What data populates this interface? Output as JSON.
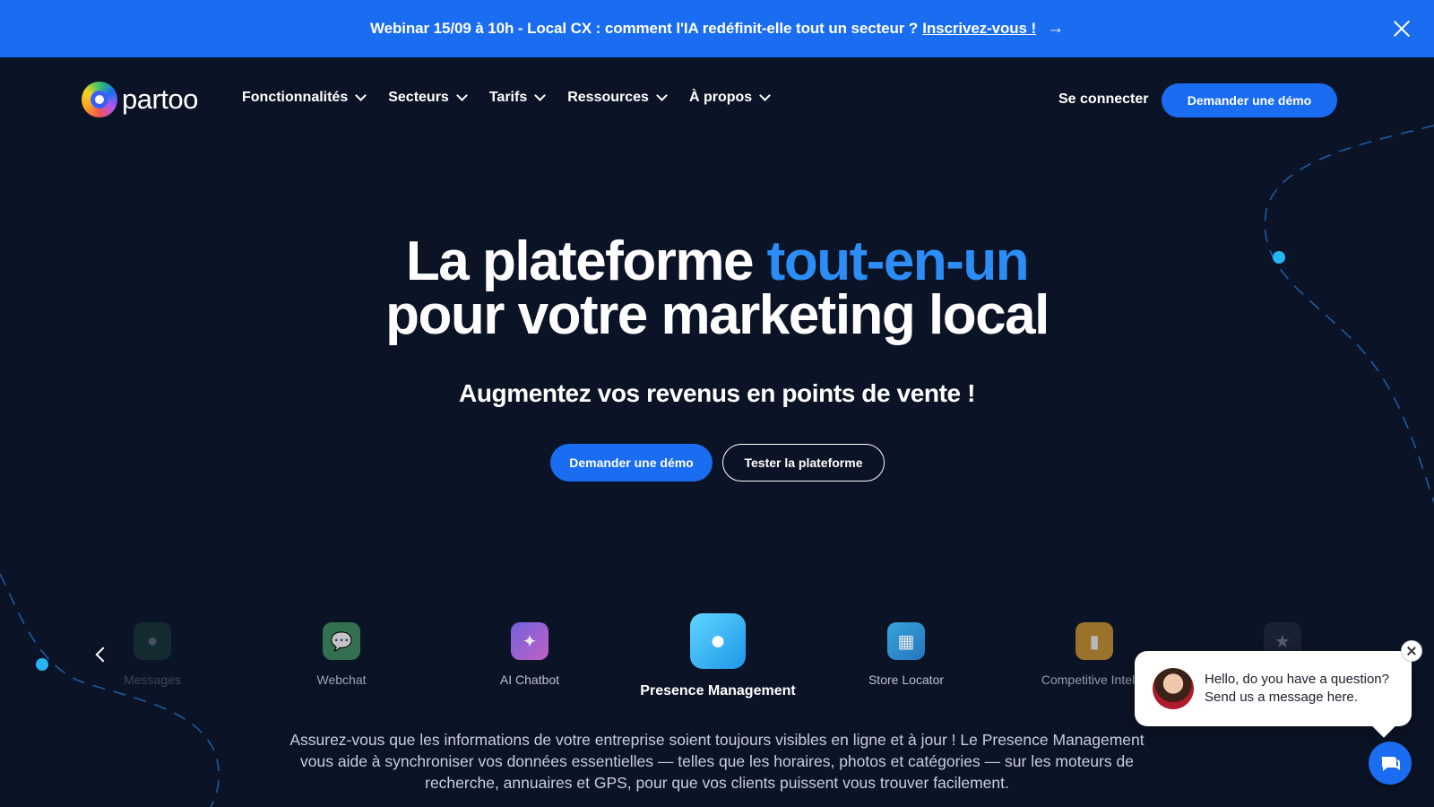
{
  "banner": {
    "text": "Webinar 15/09 à 10h - Local CX : comment l'IA redéfinit-elle tout un secteur ?",
    "link": "Inscrivez-vous !",
    "arrow_icon": "arrow-right-icon",
    "close_icon": "close-icon",
    "background": "#1a6cf0"
  },
  "nav": {
    "logo_text": "partoo",
    "items": [
      {
        "label": "Fonctionnalités"
      },
      {
        "label": "Secteurs"
      },
      {
        "label": "Tarifs"
      },
      {
        "label": "Ressources"
      },
      {
        "label": "À propos"
      }
    ],
    "login": "Se connecter",
    "demo": "Demander une démo"
  },
  "hero": {
    "title_part1": "La plateforme",
    "title_accent": "tout-en-un",
    "title_line2": "pour votre marketing local",
    "subtitle": "Augmentez vos revenus en points de vente !",
    "cta_primary": "Demander une démo",
    "cta_secondary": "Tester la plateforme",
    "accent_color": "#2b8df5"
  },
  "features": {
    "items": [
      {
        "label": "Messages",
        "icon": "messages-icon",
        "color": "#2f6b4f"
      },
      {
        "label": "Webchat",
        "icon": "webchat-icon",
        "color": "#3f8f5f"
      },
      {
        "label": "AI Chatbot",
        "icon": "sparkle-icon",
        "color": "#a45ad6"
      },
      {
        "label": "Presence Management",
        "icon": "presence-icon",
        "color": "#27b4f2"
      },
      {
        "label": "Store Locator",
        "icon": "store-icon",
        "color": "#2a9fd8"
      },
      {
        "label": "Competitive Intellig",
        "icon": "podium-icon",
        "color": "#d99a2b"
      },
      {
        "label": "",
        "icon": "star-icon",
        "color": "#3a3f55"
      }
    ],
    "active_index": 3,
    "description": "Assurez-vous que les informations de votre entreprise soient toujours visibles en ligne et à jour ! Le Presence Management vous aide à synchroniser vos données essentielles — telles que les horaires, photos et catégories — sur les moteurs de recherche, annuaires et GPS, pour que vos clients puissent vous trouver facilement."
  },
  "chat": {
    "line1": "Hello, do you have a question?",
    "line2": "Send us a message here.",
    "launcher_icon": "chat-icon"
  }
}
